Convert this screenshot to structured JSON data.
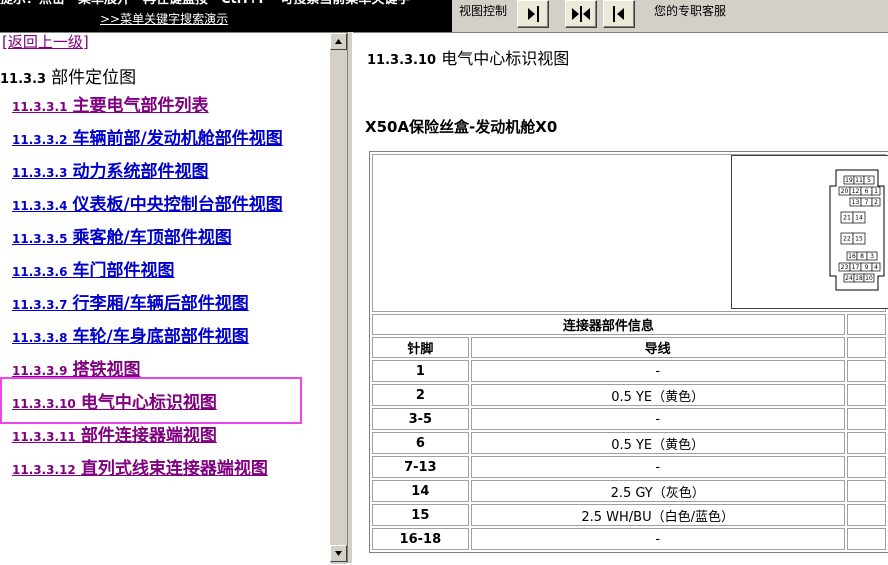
{
  "topbar": {
    "hint_line1": "提示：点击　菜单展开　再在键盘按　Ctrl+F　可搜索当前菜单关键字",
    "hint_link": ">>菜单关键字搜索演示",
    "view_control_label": "视图控制",
    "service_text": "您的专职客服"
  },
  "nav": {
    "back_label": "[返回上一级]",
    "section_num": "11.3.3",
    "section_title": "部件定位图",
    "items": [
      {
        "num": "11.3.3.1",
        "label": "主要电气部件列表"
      },
      {
        "num": "11.3.3.2",
        "label": "车辆前部/发动机舱部件视图"
      },
      {
        "num": "11.3.3.3",
        "label": "动力系统部件视图"
      },
      {
        "num": "11.3.3.4",
        "label": "仪表板/中央控制台部件视图"
      },
      {
        "num": "11.3.3.5",
        "label": "乘客舱/车顶部件视图"
      },
      {
        "num": "11.3.3.6",
        "label": "车门部件视图"
      },
      {
        "num": "11.3.3.7",
        "label": "行李厢/车辆后部件视图"
      },
      {
        "num": "11.3.3.8",
        "label": "车轮/车身底部部件视图"
      },
      {
        "num": "11.3.3.9",
        "label": "搭铁视图"
      },
      {
        "num": "11.3.3.10",
        "label": "电气中心标识视图"
      },
      {
        "num": "11.3.3.11",
        "label": "部件连接器端视图"
      },
      {
        "num": "11.3.3.12",
        "label": "直列式线束连接器端视图"
      }
    ]
  },
  "content": {
    "doc_num": "11.3.3.10",
    "doc_title": "电气中心标识视图",
    "connector_title": "X50A保险丝盒-发动机舱X0",
    "table": {
      "info_header": "连接器部件信息",
      "col_pin": "针脚",
      "col_wire": "导线",
      "rows": [
        {
          "pin": "1",
          "wire": "-"
        },
        {
          "pin": "2",
          "wire": "0.5 YE（黄色）"
        },
        {
          "pin": "3-5",
          "wire": "-"
        },
        {
          "pin": "6",
          "wire": "0.5 YE（黄色）"
        },
        {
          "pin": "7-13",
          "wire": "-"
        },
        {
          "pin": "14",
          "wire": "2.5 GY（灰色）"
        },
        {
          "pin": "15",
          "wire": "2.5 WH/BU（白色/蓝色）"
        },
        {
          "pin": "16-18",
          "wire": "-"
        }
      ]
    },
    "connector_pin_labels": [
      "19",
      "11",
      "5",
      "20",
      "12",
      "6",
      "1",
      "13",
      "7",
      "2",
      "21",
      "14",
      "22",
      "15",
      "16",
      "8",
      "3",
      "23",
      "17",
      "9",
      "4",
      "24",
      "18",
      "10"
    ]
  }
}
